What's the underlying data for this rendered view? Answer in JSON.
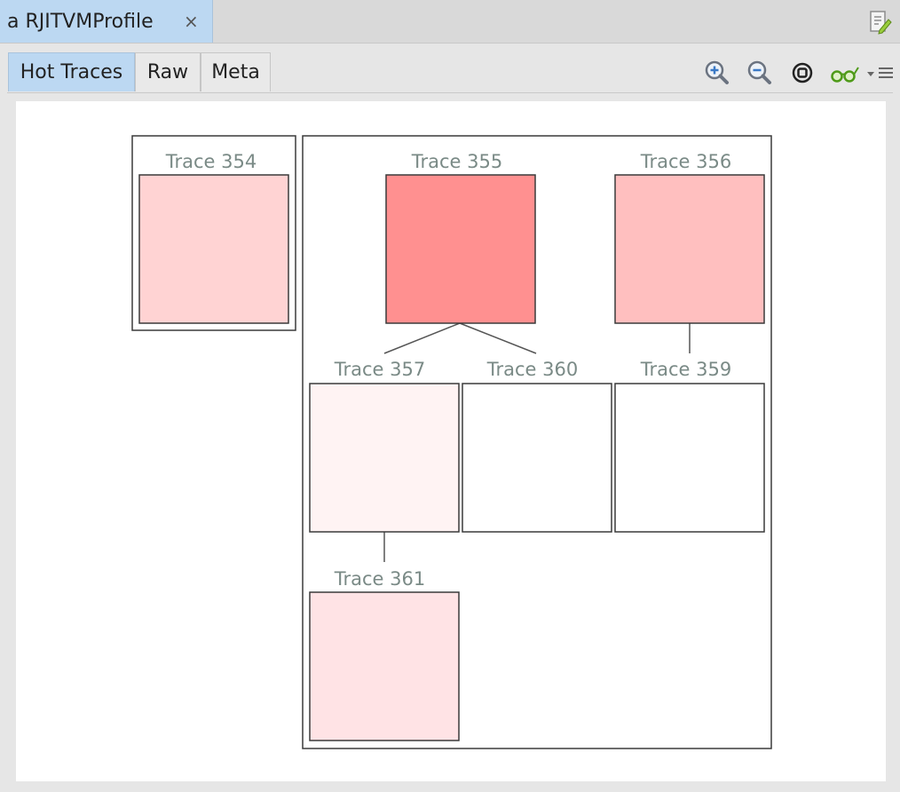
{
  "window": {
    "tab_title": "a RJITVMProfile",
    "close_glyph": "×",
    "edit_icon": "edit-icon"
  },
  "tabs": [
    {
      "label": "Hot Traces",
      "active": true
    },
    {
      "label": "Raw",
      "active": false
    },
    {
      "label": "Meta",
      "active": false
    }
  ],
  "toolbar": {
    "zoom_in_icon": "zoom-in-icon",
    "zoom_out_icon": "zoom-out-icon",
    "zoom_reset_icon": "zoom-reset-icon",
    "inspect_icon": "glasses-icon",
    "dropdown_icon": "chevron-down-icon",
    "menu_icon": "menu-icon"
  },
  "colors": {
    "active_tab": "#bcd8f2",
    "trace_label": "#7a8a86",
    "trace_354": "#ffd3d3",
    "trace_355": "#ff9090",
    "trace_356": "#ffbfbf",
    "trace_357": "#fff3f3",
    "trace_360": "#ffffff",
    "trace_359": "#ffffff",
    "trace_361": "#ffe3e5"
  },
  "traces": {
    "t354": {
      "label": "Trace 354"
    },
    "t355": {
      "label": "Trace 355"
    },
    "t356": {
      "label": "Trace 356"
    },
    "t357": {
      "label": "Trace 357"
    },
    "t360": {
      "label": "Trace 360"
    },
    "t359": {
      "label": "Trace 359"
    },
    "t361": {
      "label": "Trace 361"
    }
  }
}
